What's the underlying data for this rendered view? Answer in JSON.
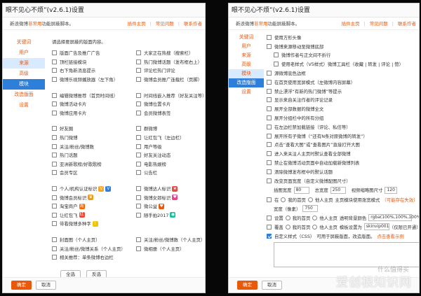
{
  "left": {
    "title": "眼不见心不烦”(v2.6.1)设置",
    "subtitle_pre": "新浪微博",
    "subtitle_hl": "非常用",
    "subtitle_post": "功能屏蔽脚本。",
    "links": [
      "插件主页",
      "常见问题",
      "联系作者"
    ],
    "sidebar": [
      "关键词",
      "用户",
      "来源",
      "高级",
      "模块",
      "改造版面",
      "设置"
    ],
    "prompt": "请选择要屏蔽的版面内容。",
    "group1": [
      [
        "版面广告及推广广告",
        "大家正在热搜（搜索栏）"
      ],
      [
        "顶栏链接模块",
        "热门微博话题（发布框右上）"
      ],
      [
        "右下角新消息提示",
        "评论栏热门评论"
      ],
      [
        "微博乐视频播放器（左下角）",
        "微博会员推广连载栏（页脚）"
      ]
    ],
    "group2": [
      [
        "编辑微博推荐（首页时间线）",
        "时间线嵌入推荐（好友关注等）"
      ],
      [
        "微博活动卡片",
        "微博位置卡片"
      ],
      [
        "微博应用卡片",
        "会员微博表签"
      ]
    ],
    "group3": [
      [
        "好友圈",
        "群微博"
      ],
      [
        "热门微博",
        "让红包飞（左边栏）"
      ],
      [
        "关注/粉丝/微博数",
        "用户等级"
      ],
      [
        "热门话题",
        "好友关注动态"
      ],
      [
        "亚洲新歌榜/好歌歌榜",
        "电影热娱榜"
      ],
      [
        "会员专区",
        "公告栏"
      ]
    ],
    "group4": [
      [
        "个人/机构认证标识",
        "微博达人标识"
      ],
      [
        "微博会员标识",
        "微博女郎标识"
      ],
      [
        "淘宝商户",
        "微公益"
      ],
      [
        "让红包飞",
        "随手拍2017"
      ],
      [
        "带看微博多种字"
      ]
    ],
    "group5": [
      [
        "封面图（个人主页）",
        "关注/粉丝/微博数（个人主页）"
      ],
      [
        "关注/粉丝/微博关系（个人主页）",
        "微相册（个人主页）"
      ],
      [
        "相关推荐：单条微博右边栏"
      ]
    ],
    "select_all": "全选",
    "invert": "反选",
    "ok": "确定",
    "cancel": "取消"
  },
  "right": {
    "title": "眼不见心不烦”(v2.6.1)设置",
    "subtitle_pre": "新浪微博",
    "subtitle_hl": "非常用",
    "subtitle_post": "功能屏蔽脚本。",
    "links": [
      "插件主页",
      "常见问题",
      "联系作者"
    ],
    "sidebar": [
      "关键词",
      "用户",
      "来源",
      "高级",
      "模块",
      "改造版面",
      "设置"
    ],
    "options": [
      {
        "label": "使用方形头像",
        "indent": 0,
        "checked": false
      },
      {
        "label": "微博来源移动至微博底部",
        "indent": 0,
        "checked": false
      },
      {
        "label": "微博作者与正文间不折行",
        "indent": 1,
        "checked": false
      },
      {
        "label": "使用老样式（V5样式）微博工具栏（收藏 | 转发 | 评论 | 赞）",
        "indent": 1,
        "checked": false
      },
      {
        "label": "源微博底色边框",
        "indent": 0,
        "checked": false
      },
      {
        "label": "在首页使用宽屏模式（左微博内容屏幕）",
        "indent": 0,
        "checked": false
      },
      {
        "label": "禁止漂浮“有新的热门微博”等提示",
        "indent": 0,
        "checked": false
      },
      {
        "label": "显示来自关注作者的评论记录",
        "indent": 0,
        "checked": false
      },
      {
        "label": "展开全部数据的微博全文",
        "indent": 0,
        "checked": false
      },
      {
        "label": "展开分组栏中的所有分组",
        "indent": 0,
        "checked": false
      },
      {
        "label": "在左边栏禁加载链接（评论、私信等）",
        "indent": 0,
        "checked": false
      },
      {
        "label": "展开所有子微博（“还有N条对原微博的转发”）",
        "indent": 0,
        "checked": false
      },
      {
        "label": "点击“查看大图”或“查看图片”直接打开大图",
        "indent": 0,
        "checked": false
      },
      {
        "label": "进入来关注人主页时默认查看全部微博",
        "indent": 0,
        "checked": false
      },
      {
        "label": "禁止在微博活动页面中自动加载新微博列表",
        "indent": 0,
        "checked": false
      },
      {
        "label": "清除微博发布框中的默认话题",
        "indent": 0,
        "checked": false
      },
      {
        "label": "改变页面宽度（自定义微博配图尺寸）",
        "indent": 0,
        "checked": false
      }
    ],
    "sizes": {
      "img_label": "插图宽度",
      "img_val": "80",
      "total_label": "总宽度",
      "total_val": "250",
      "video_label": "视频缩略图尺寸",
      "video_val": "120"
    },
    "scope_row": {
      "label": "在",
      "opt1": "我的首页",
      "opt2": "他人主页",
      "note": "主页模块使用涨宽模式",
      "hint": "（可能存在失效）"
    },
    "width_row": {
      "label": "宽度（像素）",
      "val": "750"
    },
    "bg_row": {
      "label": "设置",
      "opt1": "我的首页",
      "opt2": "他人主页",
      "opt3": "透明背景颜色",
      "val": "rgba(100%,100%,100%,0.2)"
    },
    "skin_row": {
      "label": "覆盖",
      "opt1": "我的首页",
      "opt2": "他人主页",
      "note": "模板设置为",
      "val": "skinvip001",
      "hint": "（仅限已开通）"
    },
    "css_row": {
      "label": "自定义样式（CSS）",
      "note": "可用于屏蔽版面，改造版面。",
      "link": "点击查看示例"
    },
    "ok": "确定",
    "cancel": "取消"
  },
  "watermark": {
    "brand": "什么值得买",
    "site": "爱创根知识网"
  },
  "colors": {
    "accent": "#e8590c",
    "select": "#2e7fd9",
    "select_light": "#d8eaff"
  }
}
